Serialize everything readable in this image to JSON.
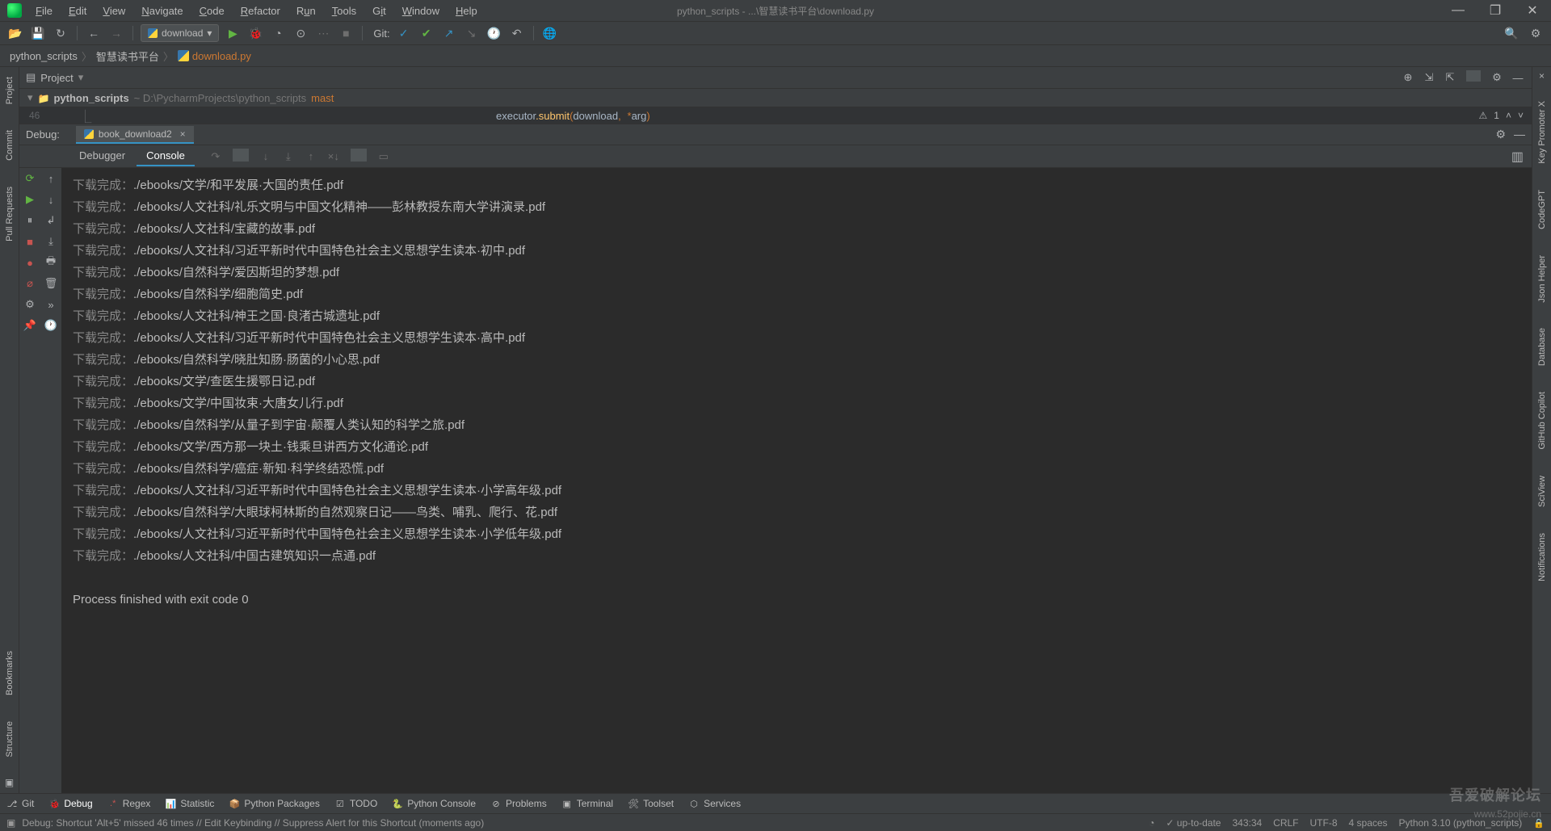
{
  "title_path": "python_scripts - ...\\智慧读书平台\\download.py",
  "menus": [
    "File",
    "Edit",
    "View",
    "Navigate",
    "Code",
    "Refactor",
    "Run",
    "Tools",
    "Git",
    "Window",
    "Help"
  ],
  "run_config": "download",
  "git_label": "Git:",
  "breadcrumbs": [
    "python_scripts",
    "智慧读书平台",
    "download.py"
  ],
  "project_panel": {
    "title": "Project",
    "root_name": "python_scripts",
    "root_path": "~  D:\\PycharmProjects\\python_scripts",
    "branch": "mast"
  },
  "editor": {
    "line_no": "46",
    "code_pre": "executor",
    "code_method": ".submit",
    "code_args": "(download, *arg)",
    "warn_count": "1"
  },
  "debug": {
    "label": "Debug:",
    "tab_name": "book_download2",
    "tabs": [
      "Debugger",
      "Console"
    ]
  },
  "console_prefix": "下载完成：",
  "console_lines": [
    "./ebooks/文学/和平发展·大国的责任.pdf",
    "./ebooks/人文社科/礼乐文明与中国文化精神——彭林教授东南大学讲演录.pdf",
    "./ebooks/人文社科/宝藏的故事.pdf",
    "./ebooks/人文社科/习近平新时代中国特色社会主义思想学生读本·初中.pdf",
    "./ebooks/自然科学/爱因斯坦的梦想.pdf",
    "./ebooks/自然科学/细胞简史.pdf",
    "./ebooks/人文社科/神王之国·良渚古城遗址.pdf",
    "./ebooks/人文社科/习近平新时代中国特色社会主义思想学生读本·高中.pdf",
    "./ebooks/自然科学/晓肚知肠·肠菌的小心思.pdf",
    "./ebooks/文学/查医生援鄂日记.pdf",
    "./ebooks/文学/中国妆束·大唐女儿行.pdf",
    "./ebooks/自然科学/从量子到宇宙·颠覆人类认知的科学之旅.pdf",
    "./ebooks/文学/西方那一块土·钱乘旦讲西方文化通论.pdf",
    "./ebooks/自然科学/癌症·新知·科学终结恐慌.pdf",
    "./ebooks/人文社科/习近平新时代中国特色社会主义思想学生读本·小学高年级.pdf",
    "./ebooks/自然科学/大眼球柯林斯的自然观察日记——鸟类、哺乳、爬行、花.pdf",
    "./ebooks/人文社科/习近平新时代中国特色社会主义思想学生读本·小学低年级.pdf",
    "./ebooks/人文社科/中国古建筑知识一点通.pdf"
  ],
  "exit_line": "Process finished with exit code 0",
  "bottom_tools": [
    "Git",
    "Debug",
    "Regex",
    "Statistic",
    "Python Packages",
    "TODO",
    "Python Console",
    "Problems",
    "Terminal",
    "Toolset",
    "Services"
  ],
  "status_hint": "Debug: Shortcut 'Alt+5' missed 46 times // Edit Keybinding // Suppress Alert for this Shortcut (moments ago)",
  "status_right": {
    "vcs": "up-to-date",
    "pos": "343:34",
    "eol": "CRLF",
    "enc": "UTF-8",
    "indent": "4 spaces",
    "sdk": "Python 3.10 (python_scripts)"
  },
  "left_tools": [
    "Project",
    "Commit",
    "Pull Requests",
    "Bookmarks",
    "Structure"
  ],
  "right_tools": [
    "Key Promoter X",
    "CodeGPT",
    "Json Helper",
    "Database",
    "GitHub Copilot",
    "SciView",
    "Notifications"
  ],
  "watermark1": "吾爱破解论坛",
  "watermark2": "www.52pojie.cn"
}
